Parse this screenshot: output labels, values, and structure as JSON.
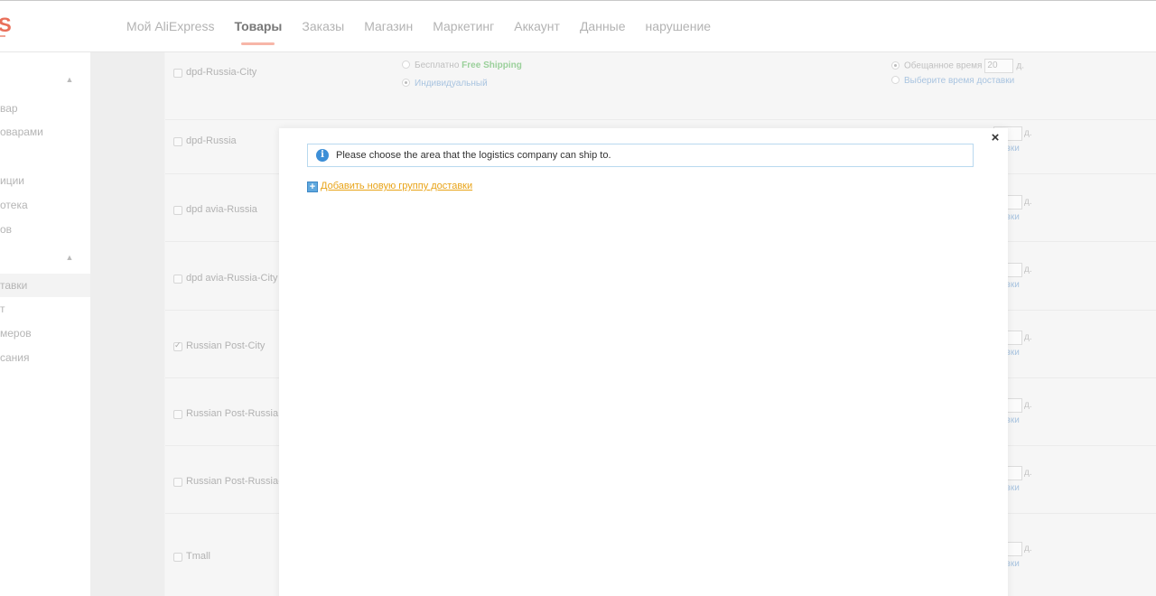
{
  "nav": {
    "logo_letter": "S",
    "items": [
      {
        "label": "Мой AliExpress",
        "active": false
      },
      {
        "label": "Товары",
        "active": true
      },
      {
        "label": "Заказы",
        "active": false
      },
      {
        "label": "Магазин",
        "active": false
      },
      {
        "label": "Маркетинг",
        "active": false
      },
      {
        "label": "Аккаунт",
        "active": false
      },
      {
        "label": "Данные",
        "active": false
      },
      {
        "label": "нарушение",
        "active": false
      }
    ]
  },
  "sidebar": {
    "items": [
      {
        "label": "вар"
      },
      {
        "label": "оварами"
      },
      {
        "label": "иции"
      },
      {
        "label": "отека"
      },
      {
        "label": "ов"
      },
      {
        "label": "тавки",
        "selected": true
      },
      {
        "label": "т"
      },
      {
        "label": "меров"
      },
      {
        "label": "сания"
      }
    ]
  },
  "shipping": {
    "free_label": "Бесплатно",
    "free_en": "Free Shipping",
    "custom_label": "Индивидуальный",
    "promised_label": "Обещанное время",
    "days_value": "20",
    "days_unit": "д.",
    "choose_time_label": "Выберите время доставки",
    "choose_time_partial": "авки",
    "rows": [
      {
        "name": "dpd-Russia-City",
        "checked": false
      },
      {
        "name": "dpd-Russia",
        "checked": false
      },
      {
        "name": "dpd avia-Russia",
        "checked": false
      },
      {
        "name": "dpd avia-Russia-City",
        "checked": false
      },
      {
        "name": "Russian Post-City",
        "checked": true
      },
      {
        "name": "Russian Post-Russia",
        "checked": false
      },
      {
        "name": "Russian Post-Russia-",
        "checked": false
      },
      {
        "name": "Tmall",
        "checked": false
      }
    ]
  },
  "modal": {
    "close_symbol": "×",
    "notice": "Please choose the area that the logistics company can ship to.",
    "info_symbol": "i",
    "plus_symbol": "+",
    "add_group_label": "Добавить новую группу доставки"
  },
  "icons": [
    "info-icon",
    "close-icon",
    "plus-icon",
    "chevron-up-icon",
    "checkbox-icon",
    "radio-icon"
  ],
  "colors": {
    "accent": "#e96f5a",
    "info_blue": "#3d8fd7",
    "link_orange": "#e8a317",
    "free_green": "#9bd09b"
  }
}
